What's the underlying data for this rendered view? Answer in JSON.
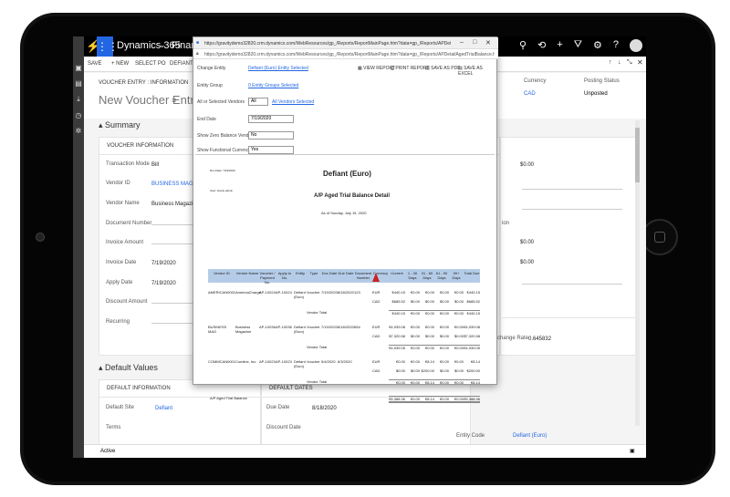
{
  "app": {
    "name": "Dynamics 365",
    "module_truncated": "Financia"
  },
  "top_icons": [
    "search-icon",
    "refresh-icon",
    "plus-icon",
    "filter-icon",
    "gear-icon",
    "help-icon",
    "avatar"
  ],
  "command_bar": {
    "save": "SAVE",
    "new": "+ NEW",
    "select_po": "SELECT PO",
    "defiant": "DEFIANT (EURO)"
  },
  "form": {
    "breadcrumb": "VOUCHER ENTRY : INFORMATION",
    "title": "New Voucher Entry",
    "header": {
      "currency_label": "Currency",
      "currency_value": "CAD",
      "posting_status_label": "Posting Status",
      "posting_status_value": "Unposted"
    },
    "summary_title": "Summary",
    "voucher_info_header": "VOUCHER INFORMATION",
    "fields": [
      {
        "label": "Transaction Mode",
        "value": "Bill"
      },
      {
        "label": "Vendor ID",
        "value": "BUSINESS MAG Business"
      },
      {
        "label": "Vendor Name",
        "value": "Business Magazine"
      },
      {
        "label": "Document Number",
        "value": ""
      },
      {
        "label": "Invoice Amount",
        "value": ""
      },
      {
        "label": "Invoice Date",
        "value": "7/19/2020"
      },
      {
        "label": "Apply Date",
        "value": "7/19/2020"
      },
      {
        "label": "Discount Amount",
        "value": ""
      },
      {
        "label": "Recurring",
        "value": ""
      }
    ],
    "right_values": [
      "$0.00",
      "$0.00",
      "$0.00"
    ],
    "right_label_partial": "ion",
    "exchange_rate_label": "Exchange Rate",
    "exchange_rate_value": "0.645832",
    "default_values_title": "Default Values",
    "default_info_header": "DEFAULT INFORMATION",
    "default_dates_header": "DEFAULT DATES",
    "default_site_label": "Default Site",
    "default_site_value": "Defiant",
    "due_date_label": "Due Date",
    "due_date_value": "8/18/2020",
    "terms_label": "Terms",
    "discount_date_label": "Discount Date",
    "entity_code_label": "Entity Code",
    "entity_code_value": "Defiant (Euro)",
    "status_footer": "Active"
  },
  "popup": {
    "title_bar": "https://gravitydemo32820.crm.dynamics.com/WebResources/gp_/Reports/ReportMainPage.htm?data=gp_/Reports/APDetailAgedTrialBalance.htm&AP Aged...",
    "url": "https://gravitydemo32820.crm.dynamics.com/WebResources/gp_/Reports/ReportMainPage.htm?data=gp_/Reports/APDetailAgedTrialBalance.htm&AP%...",
    "params": {
      "change_entity_label": "Change Entity",
      "change_entity_value": "Defiant (Euro) Entity Selected",
      "entity_group_label": "Entity Group",
      "entity_group_value": "0 Entity Groups Selected",
      "vendors_label": "All or Selected Vendors",
      "vendors_select": "All",
      "vendors_link": "All Vendors Selected",
      "end_date_label": "End Date",
      "end_date_value": "7/19/2020",
      "zero_balance_label": "Show Zero Balance Vendor",
      "zero_balance_value": "No",
      "functional_currency_label": "Show Functional Currency",
      "functional_currency_value": "Yes"
    },
    "actions": {
      "view": "VIEW REPORT",
      "print": "PRINT REPORT",
      "pdf": "SAVE AS PDF",
      "excel": "SAVE AS EXCEL"
    },
    "report": {
      "run_date": "Run Date: 7/19/2020",
      "user": "User: bcarty admin",
      "company": "Defiant (Euro)",
      "title": "A/P Aged Trial Balance Detail",
      "as_of": "As of Sunday, July 19, 2020",
      "columns": [
        "Vendor ID",
        "Vendor Name",
        "Voucher / Payment No.",
        "Apply to No.",
        "Entity",
        "Type",
        "Doc Date",
        "Due Date",
        "Document Number",
        "Currency",
        "Current",
        "1 - 30 Days",
        "31 - 60 Days",
        "61 - 90 Days",
        "90+ Days",
        "Total Due"
      ],
      "rows": [
        {
          "vendor_id": "AMERICAN0001",
          "vendor_name": "AmericaCharge",
          "voucher": "AP-10024",
          "apply": "AP-10024",
          "entity": "Defiant (Euro)",
          "type": "Voucher",
          "doc": "7/19/2020",
          "due": "8/18/2020",
          "docnum": "123",
          "lines": [
            {
              "cur": "EUR",
              "vals": [
                "€440.15",
                "€0.00",
                "€0.00",
                "€0.00",
                "€0.00",
                "€440.15"
              ]
            },
            {
              "cur": "CAD",
              "vals": [
                "$685.52",
                "$0.00",
                "$0.00",
                "$0.00",
                "$0.00",
                "$685.52"
              ]
            }
          ],
          "total": [
            "€440.15",
            "€0.00",
            "€0.00",
            "€0.00",
            "€0.00",
            "€440.15"
          ]
        },
        {
          "vendor_id": "BUSINESS MAG",
          "vendor_name": "Business Magazine",
          "voucher": "AP-10036",
          "apply": "AP-10036",
          "entity": "Defiant (Euro)",
          "type": "Voucher",
          "doc": "7/19/2020",
          "due": "8/18/2020",
          "docnum": "654",
          "lines": [
            {
              "cur": "EUR",
              "vals": [
                "€4,939.08",
                "€0.00",
                "€0.00",
                "€0.00",
                "€0.00",
                "€4,939.08"
              ]
            },
            {
              "cur": "CAD",
              "vals": [
                "$7,320.58",
                "$0.00",
                "$0.00",
                "$0.00",
                "$0.00",
                "$7,320.58"
              ]
            }
          ],
          "total": [
            "€4,939.05",
            "€0.00",
            "€0.00",
            "€0.00",
            "€0.00",
            "€4,939.05"
          ]
        },
        {
          "vendor_id": "COMMCAN0001",
          "vendor_name": "Comline, Inc.",
          "voucher": "AP-10023",
          "apply": "AP-10023",
          "entity": "Defiant (Euro)",
          "type": "Voucher",
          "doc": "5/4/2020",
          "due": "6/3/2020",
          "docnum": "",
          "lines": [
            {
              "cur": "EUR",
              "vals": [
                "€0.00",
                "€0.00",
                "€8.14",
                "€0.00",
                "€0.00",
                "€8.14"
              ]
            },
            {
              "cur": "CAD",
              "vals": [
                "$0.00",
                "$0.00",
                "$200.00",
                "$0.00",
                "$0.00",
                "$200.00"
              ]
            }
          ],
          "total": [
            "€0.00",
            "€0.00",
            "€8.14",
            "€0.00",
            "€0.00",
            "€8.14"
          ]
        }
      ],
      "vendor_total_label": "Vendor Total",
      "grand_total_label": "A/P Aged Trial Balance",
      "grand_total": [
        "€5,388.36",
        "€0.00",
        "€8.14",
        "€0.00",
        "€0.00",
        "€5,388.36"
      ]
    }
  }
}
